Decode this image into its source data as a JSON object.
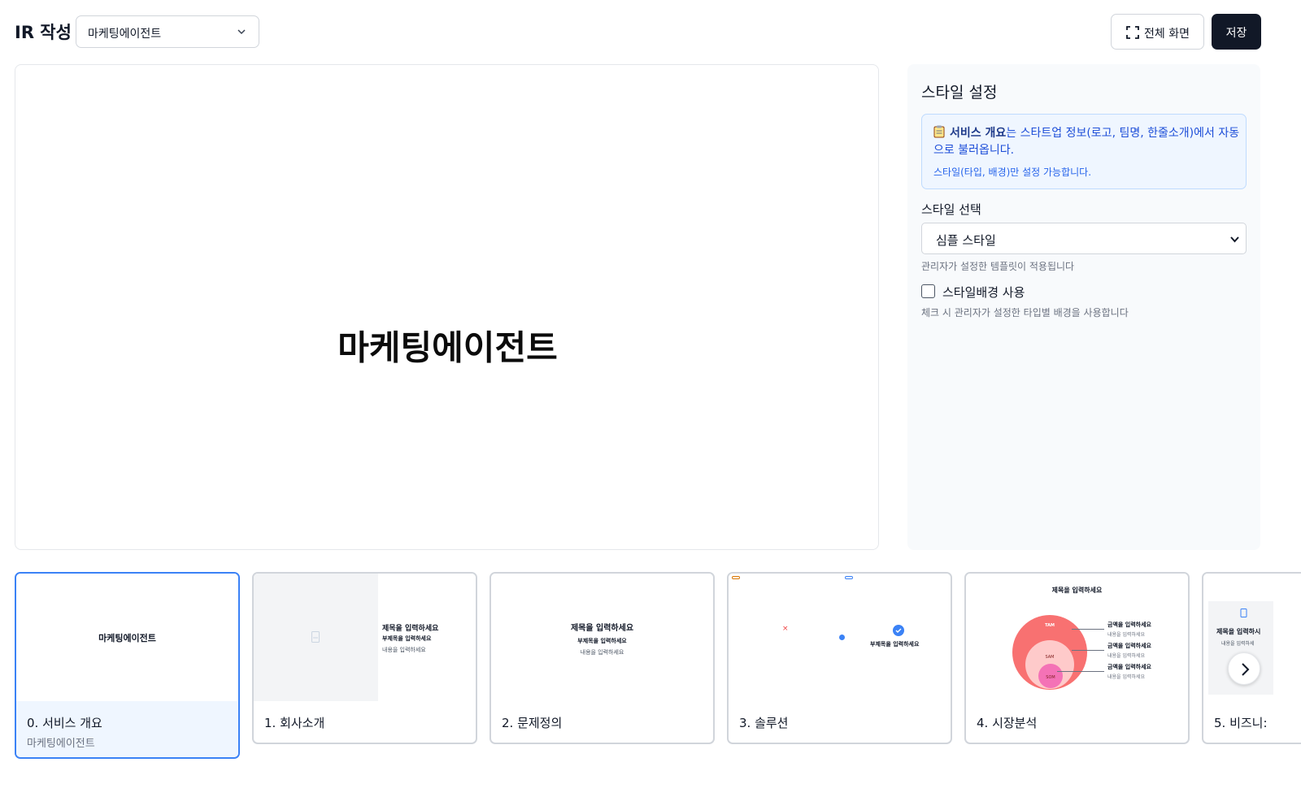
{
  "header": {
    "title": "IR 작성",
    "project_select_value": "마케팅에이전트",
    "fullscreen_label": "전체 화면",
    "save_label": "저장"
  },
  "canvas": {
    "title": "마케팅에이전트"
  },
  "style_panel": {
    "title": "스타일 설정",
    "info_bold": "서비스 개요",
    "info_rest": "는 스타트업 정보(로고, 팀명, 한줄소개)에서 자동으로 불러옵니다.",
    "info_sub": "스타일(타입, 배경)만 설정 가능합니다.",
    "style_label": "스타일 선택",
    "style_value": "심플 스타일",
    "style_hint": "관리자가 설정한 템플릿이 적용됩니다",
    "bg_checkbox_label": "스타일배경 사용",
    "bg_checkbox_checked": false,
    "bg_hint": "체크 시 관리자가 설정한 타입별 배경을 사용합니다"
  },
  "slides": [
    {
      "label": "0. 서비스 개요",
      "sub": "마케팅에이전트",
      "active": true,
      "thumb_title": "마케팅에이전트"
    },
    {
      "label": "1. 회사소개",
      "thumb_title": "제목을 입력하세요",
      "thumb_subtitle": "부제목을 입력하세요",
      "thumb_body": "내용을 입력하세요"
    },
    {
      "label": "2. 문제정의",
      "thumb_title": "제목을 입력하세요",
      "thumb_subtitle": "부제목을 입력하세요",
      "thumb_body": "내용을 입력하세요"
    },
    {
      "label": "3. 솔루션",
      "thumb_subtitle": "부제목을 입력하세요"
    },
    {
      "label": "4. 시장분석",
      "thumb_title": "제목을 입력하세요",
      "tam": "TAM",
      "sam": "SAM",
      "som": "SOM",
      "amount_label": "금액을 입력하세요",
      "body": "내용을 입력하세요"
    },
    {
      "label": "5. 비즈니:",
      "thumb_title": "제목을 입력하시",
      "thumb_body": "내용을 입력하세"
    }
  ],
  "colors": {
    "accent": "#3b82f6",
    "dark_button": "#111827",
    "info_bg": "#eff6ff",
    "tam": "#f87171",
    "sam": "#fecaca",
    "som": "#f472b6"
  }
}
